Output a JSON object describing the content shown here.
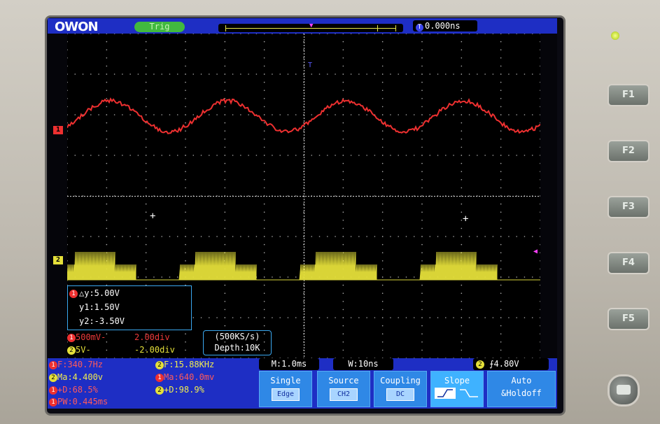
{
  "header": {
    "brand": "OWON",
    "trigger_status": "Trig",
    "time_position_icon": "T",
    "time_position": "0.000ns"
  },
  "markers": {
    "ch1": "1",
    "ch2": "2"
  },
  "cursor": {
    "delta_y": "△y:5.00V",
    "y1": "y1:1.50V",
    "y2": "y2:-3.50V"
  },
  "channels": {
    "ch1_scale": "500mV-",
    "ch1_offset": "2.00div",
    "ch2_scale": "5V-",
    "ch2_offset": "-2.00div"
  },
  "acquisition": {
    "rate": "(500KS/s)",
    "depth": "Depth:10K"
  },
  "measurements": {
    "ch1_freq": "F:340.7Hz",
    "ch1_amp": "Ma:4.400v",
    "ch1_duty": "+D:68.5%",
    "ch1_pw": "PW:0.445ms",
    "ch2_freq": "F:15.88KHz",
    "ch2_amp": "Ma:640.0mv",
    "ch2_duty": "+D:98.9%"
  },
  "timebase": {
    "main": "M:1.0ms",
    "window": "W:10ns",
    "trigger_level": "4.80V"
  },
  "menu": [
    {
      "label": "Single",
      "value": "Edge"
    },
    {
      "label": "Source",
      "value": "CH2"
    },
    {
      "label": "Coupling",
      "value": "DC"
    },
    {
      "label": "Slope",
      "value": ""
    },
    {
      "label": "Auto",
      "value": "&Holdoff"
    }
  ],
  "function_keys": [
    "F1",
    "F2",
    "F3",
    "F4",
    "F5"
  ],
  "colors": {
    "ch1": "#ee3030",
    "ch2": "#e5e03a",
    "panel": "#1e2ec4",
    "grid": "#ffffff"
  }
}
